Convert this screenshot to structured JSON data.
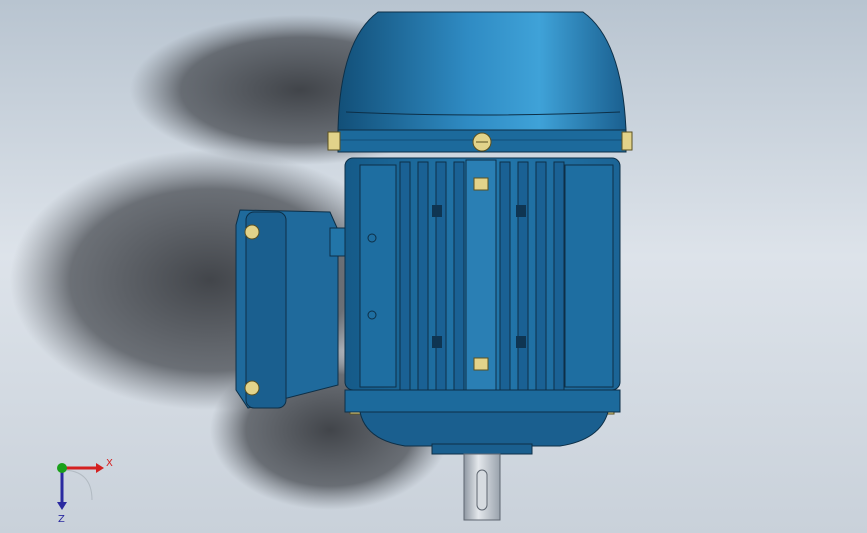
{
  "viewport": {
    "model_name": "",
    "model_color": "#1f6f9f",
    "hardware_color": "#e2d38a",
    "shaft_color": "#c9cfd6",
    "background_top": "#b8c4d0",
    "background_bottom": "#c9d1da"
  },
  "triad": {
    "x_label": "X",
    "z_label": "Z",
    "x_color": "#d42020",
    "z_color": "#2a2aa0",
    "y_color": "#1aa01a"
  }
}
